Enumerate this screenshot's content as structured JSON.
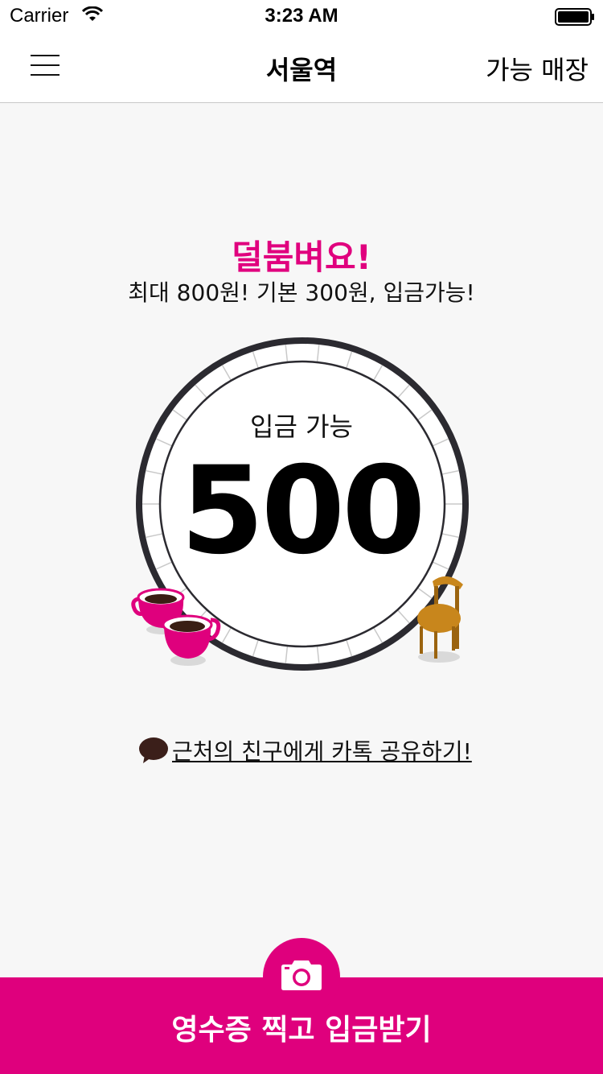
{
  "status_bar": {
    "carrier": "Carrier",
    "time": "3:23 AM",
    "wifi_icon": "wifi-icon",
    "battery_icon": "battery-icon"
  },
  "nav": {
    "menu_icon": "hamburger-menu-icon",
    "title": "서울역",
    "right_label": "가능 매장"
  },
  "promo": {
    "headline": "덜붐벼요!",
    "subline": "최대 800원! 기본 300원, 입금가능!"
  },
  "dial": {
    "label": "입금 가능",
    "value": "500"
  },
  "share": {
    "icon": "kakao-talk-bubble-icon",
    "label": "근처의 친구에게 카톡 공유하기!"
  },
  "cta": {
    "icon": "camera-icon",
    "label": "영수증 찍고 입금받기"
  },
  "colors": {
    "accent": "#e0007e",
    "background": "#f7f7f7",
    "dial_ring": "#2b2a30",
    "chair": "#c8861c",
    "kakao_bubble": "#3b1f1a"
  }
}
